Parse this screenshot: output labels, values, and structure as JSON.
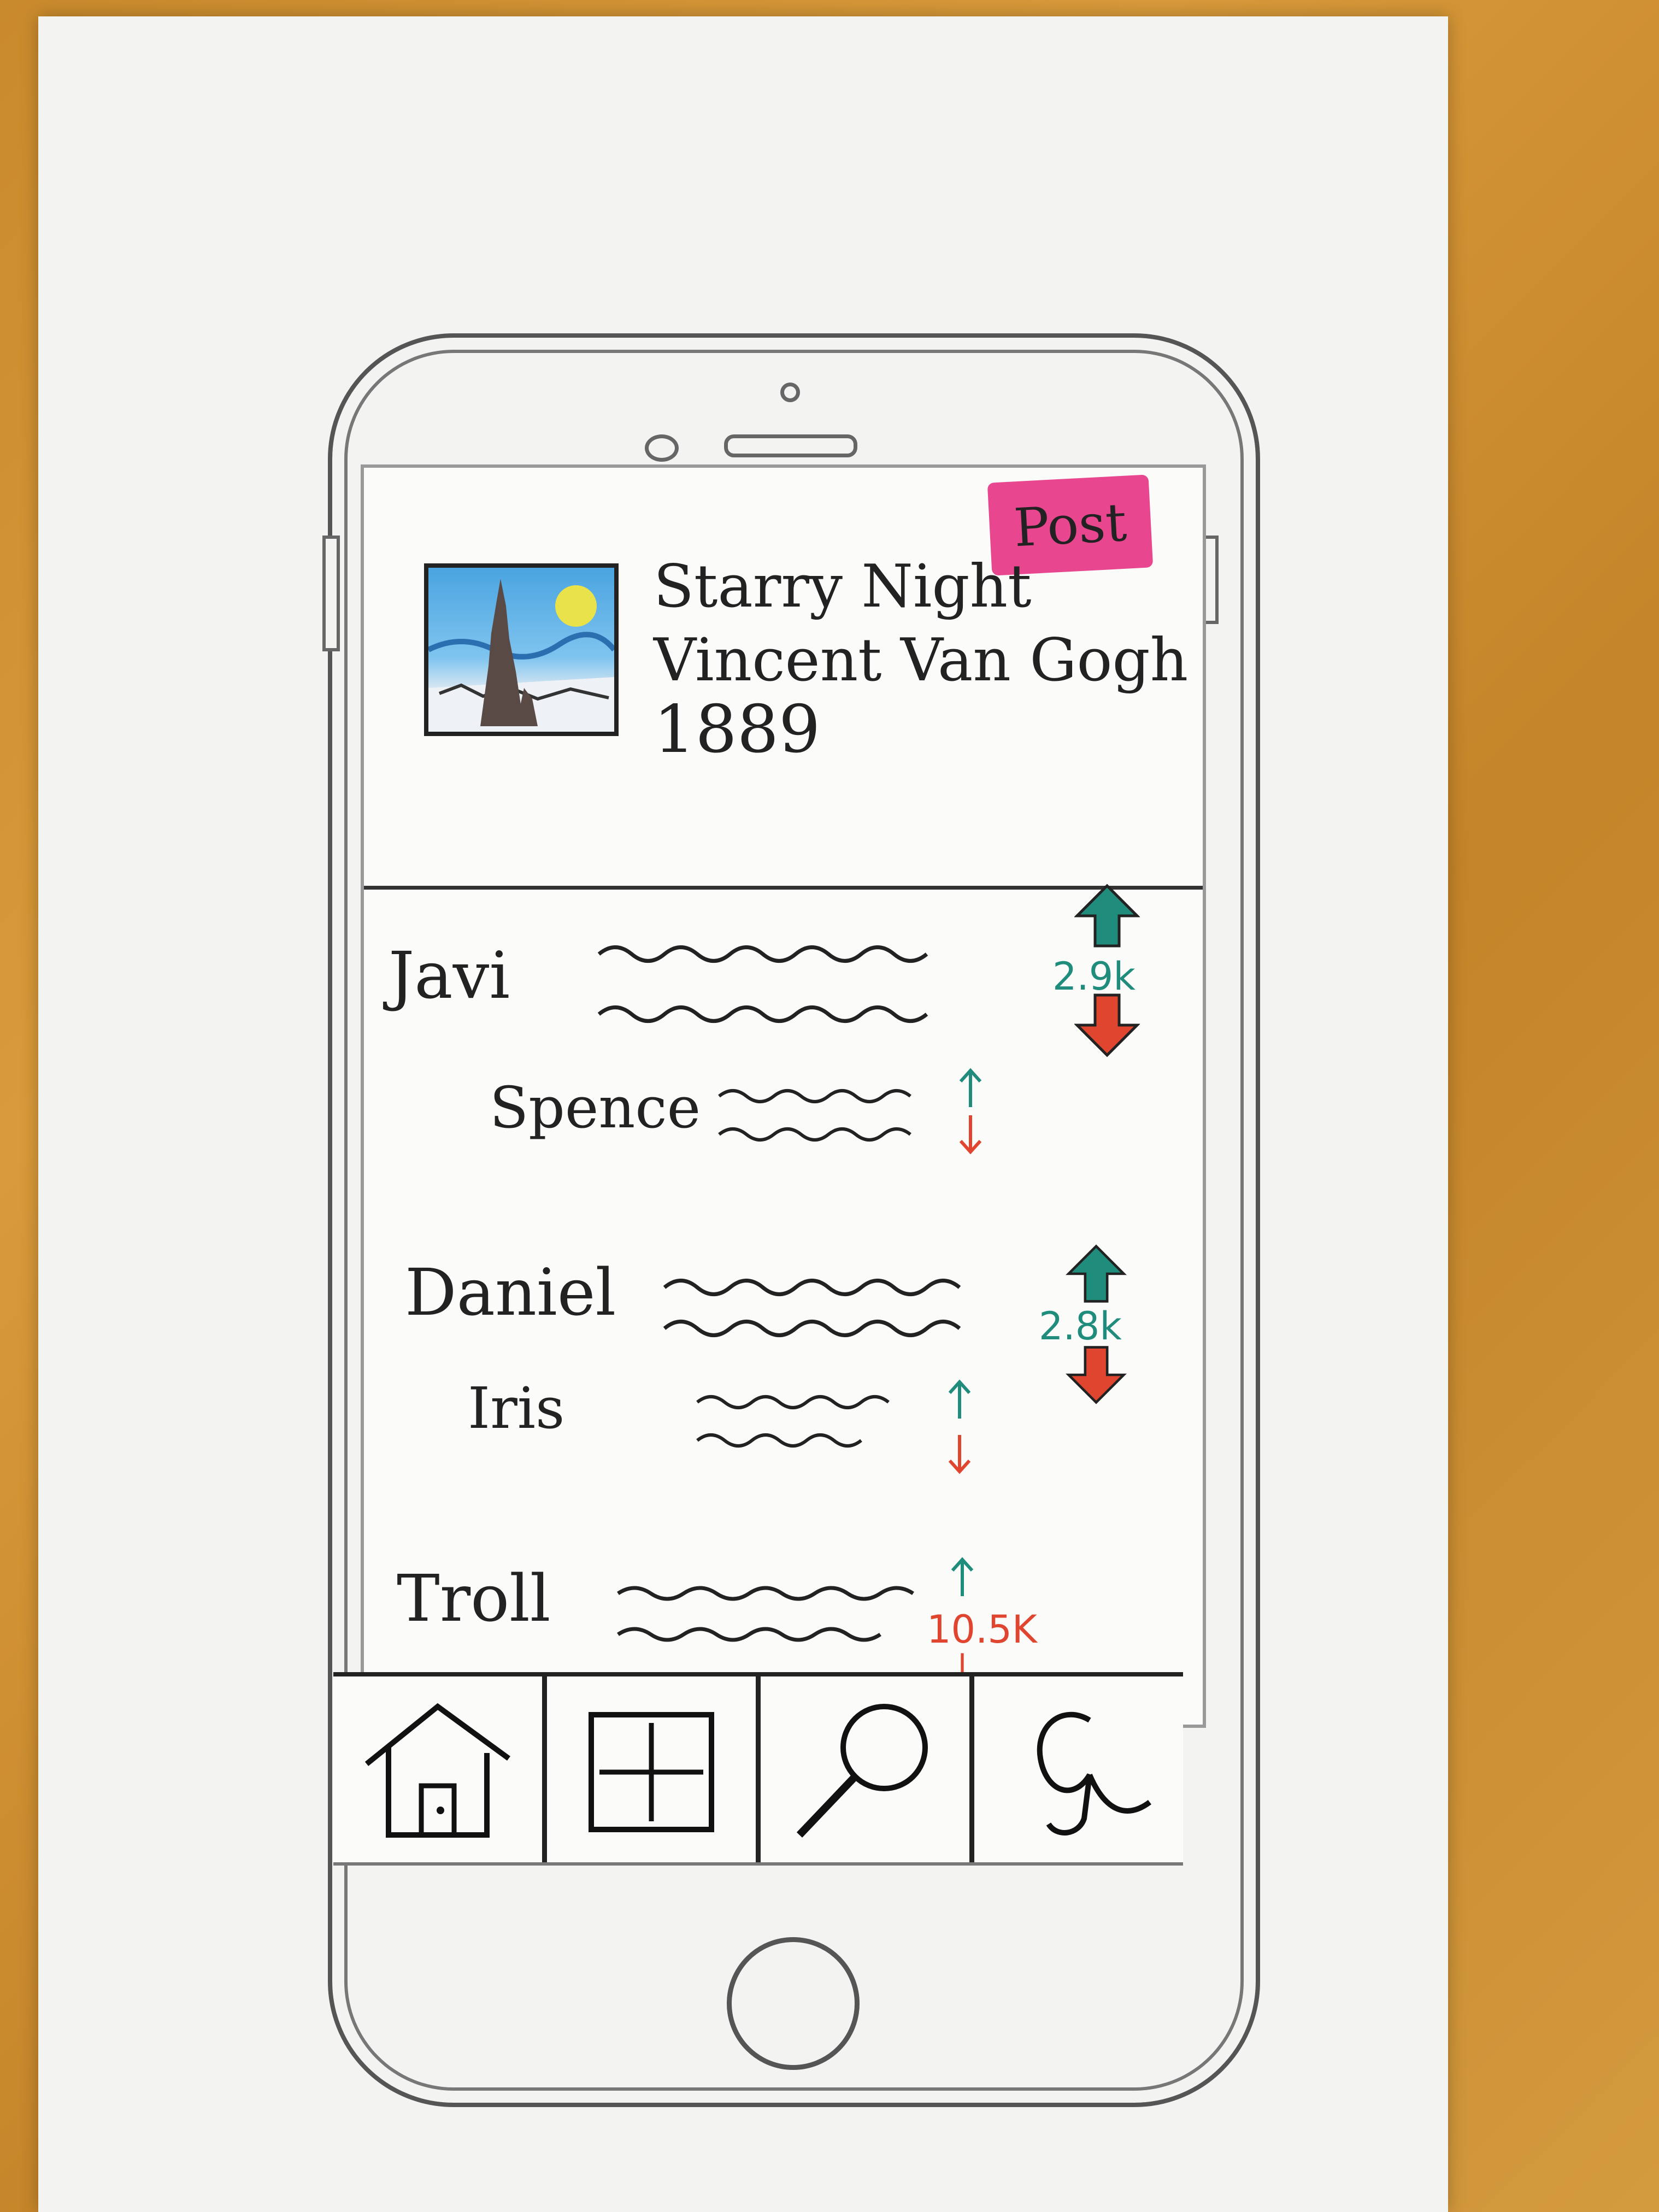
{
  "header": {
    "post_label": "Post"
  },
  "artwork": {
    "title": "Starry Night",
    "artist": "Vincent Van Gogh",
    "year": "1889"
  },
  "comments": [
    {
      "name": "Javi",
      "score": "2.9k",
      "reply": {
        "name": "Spence"
      }
    },
    {
      "name": "Daniel",
      "score": "2.8k",
      "reply": {
        "name": "Iris"
      }
    },
    {
      "name": "Troll",
      "score": "10.5K"
    }
  ],
  "tab_bar": {
    "icons": [
      "home-icon",
      "grid-icon",
      "search-icon",
      "gallery-icon"
    ]
  },
  "colors": {
    "post_button": "#e8478f",
    "upvote": "#1f8c7c",
    "downvote": "#e0462f",
    "troll_score": "#e0462f"
  }
}
